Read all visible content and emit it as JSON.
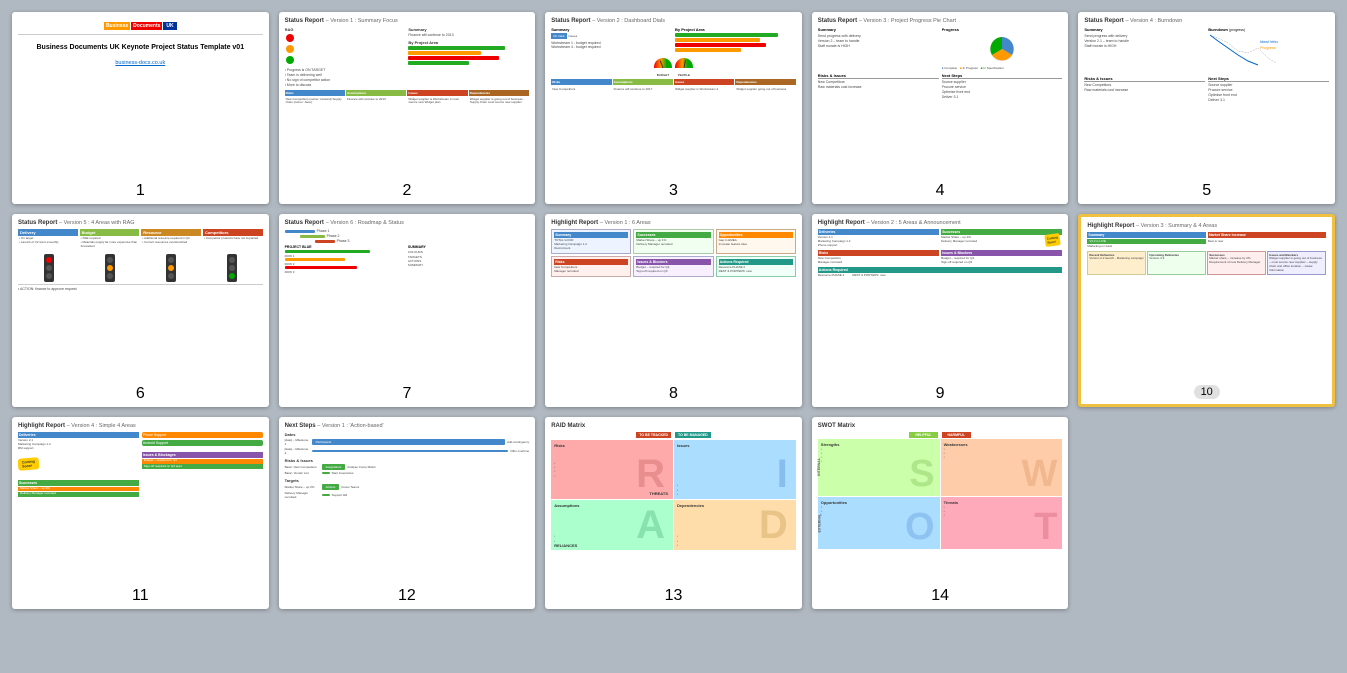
{
  "slides": [
    {
      "id": 1,
      "type": "title",
      "logo": [
        "Business",
        "Documents",
        "UK"
      ],
      "title": "Business Documents UK\nKeynote Project Status Template\nv01",
      "link": "business-docs.co.uk",
      "number": "1"
    },
    {
      "id": 2,
      "type": "status-report",
      "title": "Status Report",
      "version": "– Version 1 : Summary Focus",
      "number": "2"
    },
    {
      "id": 3,
      "type": "status-report",
      "title": "Status Report",
      "version": "– Version 2 : Dashboard Dials",
      "number": "3"
    },
    {
      "id": 4,
      "type": "status-report",
      "title": "Status Report",
      "version": "– Version 3 : Project Progress Pie Chart",
      "number": "4"
    },
    {
      "id": 5,
      "type": "status-report",
      "title": "Status Report",
      "version": "– Version 4 : Burndown",
      "number": "5"
    },
    {
      "id": 6,
      "type": "status-report",
      "title": "Status Report",
      "version": "– Version 5 : 4 Areas with RAG",
      "number": "6"
    },
    {
      "id": 7,
      "type": "status-report",
      "title": "Status Report",
      "version": "– Version 6 : Roadmap & Status",
      "number": "7"
    },
    {
      "id": 8,
      "type": "highlight-report",
      "title": "Highlight Report",
      "version": "– Version 1 : 6 Areas",
      "number": "8"
    },
    {
      "id": 9,
      "type": "highlight-report",
      "title": "Highlight Report",
      "version": "– Version 2 : 5 Areas & Announcement",
      "number": "9"
    },
    {
      "id": 10,
      "type": "highlight-report",
      "title": "Highlight Report",
      "version": "– Version 3 : Summary & 4 Areas",
      "number": "10",
      "highlighted": true
    },
    {
      "id": 11,
      "type": "highlight-report",
      "title": "Highlight Report",
      "version": "– Version 4 : Simple 4 Areas",
      "number": "11"
    },
    {
      "id": 12,
      "type": "next-steps",
      "title": "Next Steps",
      "version": "– Version 1 : 'Action-based'",
      "number": "12"
    },
    {
      "id": 13,
      "type": "raid",
      "title": "RAID Matrix",
      "version": "",
      "number": "13"
    },
    {
      "id": 14,
      "type": "swot",
      "title": "SWOT Matrix",
      "version": "",
      "number": "14"
    }
  ]
}
